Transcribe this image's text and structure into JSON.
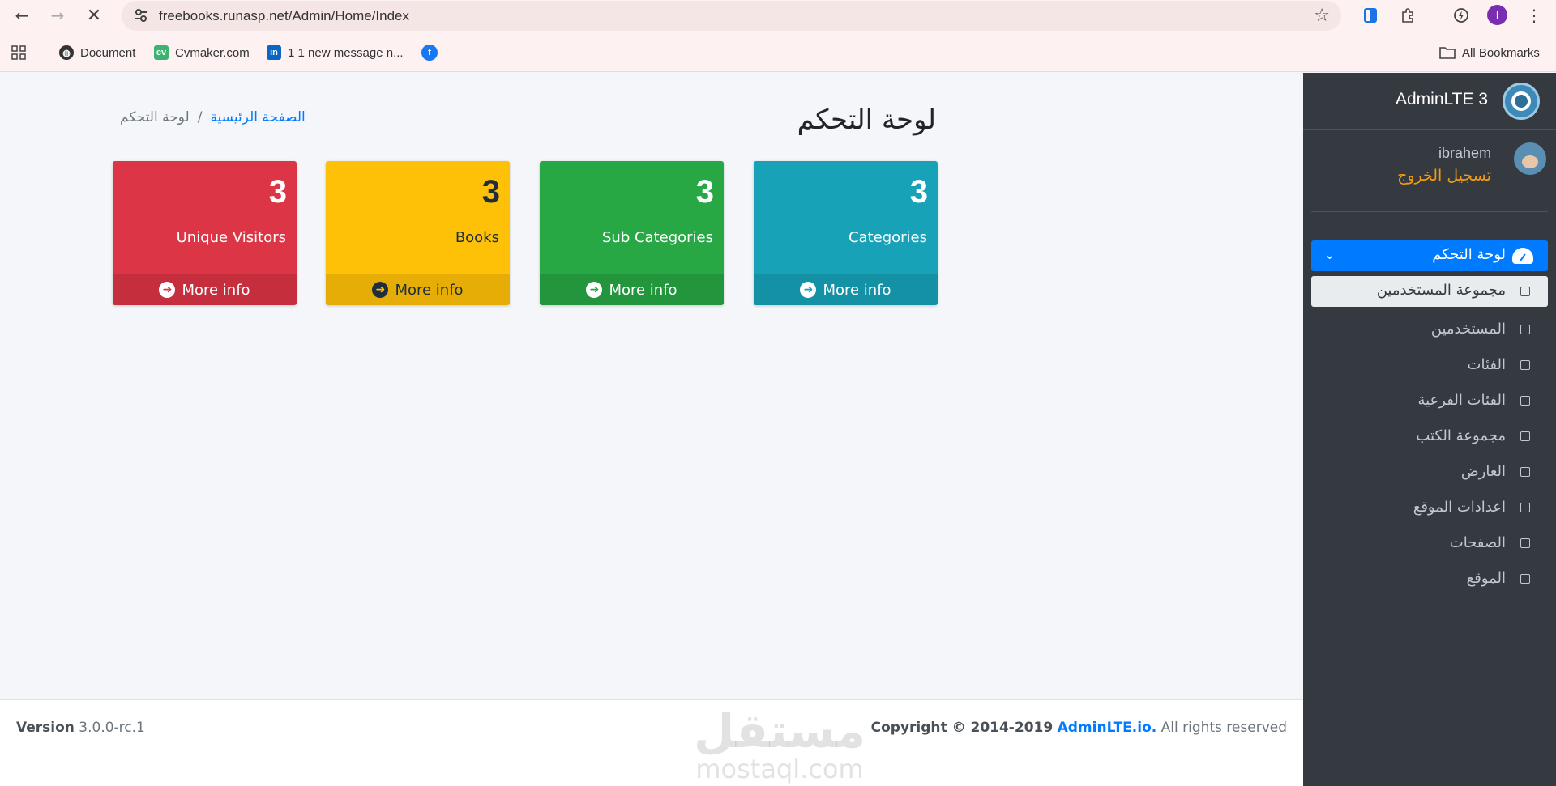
{
  "browser": {
    "url": "freebooks.runasp.net/Admin/Home/Index",
    "profile_initial": "I",
    "bookmarks": [
      {
        "label": "Document",
        "icon": "globe-icon"
      },
      {
        "label": "Cvmaker.com",
        "icon": "cvmaker-icon"
      },
      {
        "label": "1 1 new message n...",
        "icon": "linkedin-icon"
      },
      {
        "label": "",
        "icon": "facebook-icon"
      }
    ],
    "all_bookmarks": "All Bookmarks"
  },
  "page": {
    "title": "لوحة التحكم",
    "breadcrumb": {
      "home": "الصفحة الرئيسية",
      "separator": "/",
      "current": "لوحة التحكم"
    }
  },
  "boxes": [
    {
      "count": "3",
      "label": "Categories",
      "more": "More info",
      "color": "#17a2b8"
    },
    {
      "count": "3",
      "label": "Sub Categories",
      "more": "More info",
      "color": "#28a745"
    },
    {
      "count": "3",
      "label": "Books",
      "more": "More info",
      "color": "#ffc107"
    },
    {
      "count": "3",
      "label": "Unique Visitors",
      "more": "More info",
      "color": "#dc3545"
    }
  ],
  "footer": {
    "version_label": "Version",
    "version": "3.0.0-rc.1",
    "copyright_prefix": "Copyright © 2014-2019",
    "copyright_link": "AdminLTE.io.",
    "copyright_suffix": "All rights reserved",
    "watermark_ar": "مستقل",
    "watermark_en": "mostaql.com"
  },
  "sidebar": {
    "brand": "AdminLTE 3",
    "username": "ibrahem",
    "logout": "تسجيل الخروج",
    "active_item": "لوحة التحكم",
    "items": [
      "مجموعة المستخدمين",
      "المستخدمين",
      "الفئات",
      "الفئات الفرعية",
      "مجموعة الكتب",
      "العارض",
      "اعدادات الموقع",
      "الصفحات",
      "الموقع"
    ]
  }
}
